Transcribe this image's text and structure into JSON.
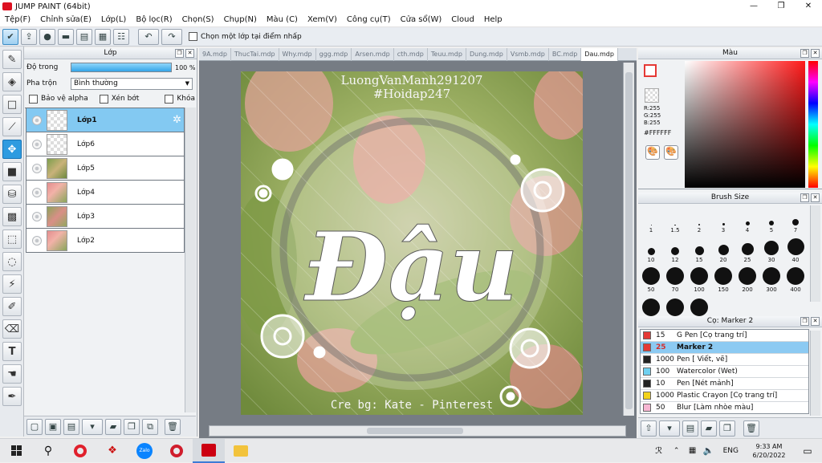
{
  "window": {
    "title": "JUMP PAINT (64bit)",
    "minimize": "—",
    "maximize": "❐",
    "close": "✕"
  },
  "menu": [
    "Tệp(F)",
    "Chỉnh sửa(E)",
    "Lớp(L)",
    "Bộ lọc(R)",
    "Chọn(S)",
    "Chụp(N)",
    "Màu (C)",
    "Xem(V)",
    "Công cụ(T)",
    "Cửa sổ(W)",
    "Cloud",
    "Help"
  ],
  "toolbar": {
    "buttons": [
      "check-icon",
      "share-icon",
      "speech-bubble-icon",
      "comment-icon",
      "page-icon",
      "grid-icon",
      "settings-list-icon"
    ],
    "undo_icon": "↶",
    "redo_icon": "↷",
    "select_layer_label": "Chọn một lớp tại điểm nhấp"
  },
  "tools": [
    "pen-icon",
    "eraser-icon",
    "rectangle-icon",
    "line-icon",
    "move-icon",
    "fill-rectangle-icon",
    "bucket-icon",
    "gradient-icon",
    "select-rect-icon",
    "lasso-icon",
    "magic-wand-icon",
    "select-pen-icon",
    "select-eraser-icon",
    "text-icon",
    "hand-icon",
    "eyedropper-icon"
  ],
  "layers_panel": {
    "title": "Lớp",
    "opacity_label": "Độ trong",
    "opacity_value": "100 %",
    "opacity_level": 1.0,
    "blend_label": "Pha trộn",
    "blend_value": "Bình thường",
    "protect_alpha": "Bảo vệ alpha",
    "clipping": "Xén bớt",
    "lock": "Khóa",
    "layers": [
      {
        "name": "Lớp1",
        "selected": true,
        "thumb": "trans"
      },
      {
        "name": "Lớp6",
        "selected": false,
        "thumb": "trans"
      },
      {
        "name": "Lớp5",
        "selected": false,
        "thumb": "img1"
      },
      {
        "name": "Lớp4",
        "selected": false,
        "thumb": "img2"
      },
      {
        "name": "Lớp3",
        "selected": false,
        "thumb": "img3"
      },
      {
        "name": "Lớp2",
        "selected": false,
        "thumb": "img2"
      }
    ]
  },
  "tabs": [
    "9A.mdp",
    "ThucTai.mdp",
    "Why.mdp",
    "ggg.mdp",
    "Arsen.mdp",
    "cth.mdp",
    "Teuu.mdp",
    "Dung.mdp",
    "Vsmb.mdp",
    "BC.mdp",
    "Dau.mdp"
  ],
  "active_tab": 10,
  "artwork": {
    "watermark_line1": "LuongVanManh291207",
    "watermark_line2": "#Hoidap247",
    "main_text": "Đậu",
    "credit": "Cre bg: Kate - Pinterest"
  },
  "color_panel": {
    "title": "Màu",
    "r": "R:255",
    "g": "G:255",
    "b": "B:255",
    "hex": "#FFFFFF"
  },
  "brush_size_panel": {
    "title": "Brush Size",
    "sizes": [
      "1",
      "1.5",
      "2",
      "3",
      "4",
      "5",
      "7",
      "10",
      "12",
      "15",
      "20",
      "25",
      "30",
      "40",
      "50",
      "70",
      "100",
      "150",
      "200",
      "300",
      "400",
      "",
      "",
      ""
    ]
  },
  "brush_panel": {
    "title": "Cọ: Marker 2",
    "brushes": [
      {
        "size": "15",
        "name": "G Pen [Cọ trang trí]",
        "color": "#e53935",
        "selected": false
      },
      {
        "size": "25",
        "name": "Marker 2",
        "color": "#e53935",
        "selected": true
      },
      {
        "size": "1000",
        "name": "Pen [ Viết, vẽ]",
        "color": "#222222",
        "selected": false
      },
      {
        "size": "100",
        "name": "Watercolor (Wet)",
        "color": "#6fd0f0",
        "selected": false
      },
      {
        "size": "10",
        "name": "Pen [Nét mảnh]",
        "color": "#222222",
        "selected": false
      },
      {
        "size": "1000",
        "name": "Plastic Crayon [Cọ trang trí]",
        "color": "#f2d21b",
        "selected": false
      },
      {
        "size": "50",
        "name": "Blur [Làm nhòe màu]",
        "color": "#f7b6d2",
        "selected": false
      }
    ]
  },
  "taskbar": {
    "apps": [
      "windows-icon",
      "search-icon",
      "opera-icon",
      "apps-icon",
      "zalo-icon",
      "opera-gx-icon",
      "jump-paint-icon",
      "file-explorer-icon"
    ],
    "zalo": "Zalo",
    "lang": "ENG",
    "time": "9:33 AM",
    "date": "6/20/2022"
  }
}
